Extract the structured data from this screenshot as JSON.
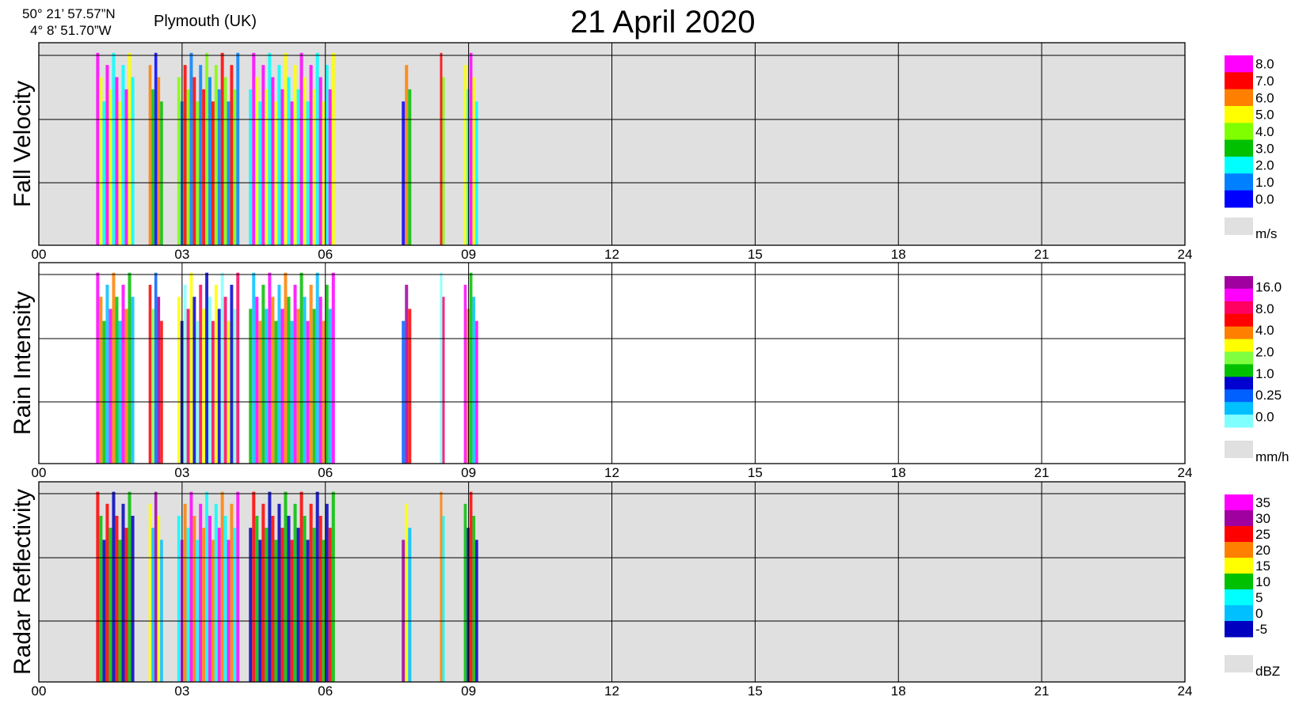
{
  "header": {
    "lat": "50° 21’ 57.57”N",
    "lon": "4°  8’ 51.70”W",
    "location": "Plymouth (UK)",
    "date": "21 April 2020"
  },
  "chart_data": [
    {
      "type": "heatmap",
      "ylabel": "Fall Velocity",
      "x_ticks": [
        "00",
        "03",
        "06",
        "09",
        "12",
        "15",
        "18",
        "21",
        "24"
      ],
      "xlim": [
        0,
        24
      ],
      "colorbar": {
        "labels": [
          "8.0",
          "7.0",
          "6.0",
          "5.0",
          "4.0",
          "3.0",
          "2.0",
          "1.0",
          "0.0"
        ],
        "colors": [
          "#ff00ff",
          "#ff0000",
          "#ff7f00",
          "#ffff00",
          "#7fff00",
          "#00c000",
          "#00ffff",
          "#0080ff",
          "#0000ff"
        ],
        "nodata_color": "#e0e0e0",
        "unit": "m/s"
      },
      "background": "#e0e0e0",
      "precip_intervals": [
        [
          1.2,
          2.0
        ],
        [
          2.3,
          2.6
        ],
        [
          2.9,
          4.2
        ],
        [
          4.4,
          6.2
        ],
        [
          7.6,
          7.8
        ],
        [
          8.4,
          8.5
        ],
        [
          8.9,
          9.2
        ]
      ],
      "dominant_values": [
        4.0,
        6.0,
        7.0,
        5.0,
        1.0,
        0.0,
        3.0
      ]
    },
    {
      "type": "heatmap",
      "ylabel": "Rain Intensity",
      "x_ticks": [
        "00",
        "03",
        "06",
        "09",
        "12",
        "15",
        "18",
        "21",
        "24"
      ],
      "xlim": [
        0,
        24
      ],
      "colorbar": {
        "labels": [
          "16.0",
          "8.0",
          "4.0",
          "2.0",
          "1.0",
          "0.25",
          "0.0"
        ],
        "colors": [
          "#a000a0",
          "#ff00ff",
          "#ff0060",
          "#ff0000",
          "#ff8000",
          "#ffff00",
          "#80ff40",
          "#00c000",
          "#0000d0",
          "#0060ff",
          "#00c0ff",
          "#80ffff"
        ],
        "nodata_color": "#e0e0e0",
        "unit": "mm/h"
      },
      "background": "#ffffff",
      "precip_intervals": [
        [
          1.2,
          2.0
        ],
        [
          2.3,
          2.6
        ],
        [
          2.9,
          4.2
        ],
        [
          4.4,
          6.2
        ],
        [
          7.6,
          7.8
        ],
        [
          8.4,
          8.5
        ],
        [
          8.9,
          9.2
        ]
      ],
      "dominant_values": [
        0.25,
        1.0,
        4.0,
        0.25,
        0.0,
        0.0,
        2.0
      ]
    },
    {
      "type": "heatmap",
      "ylabel": "Radar Reflectivity",
      "x_ticks": [
        "00",
        "03",
        "06",
        "09",
        "12",
        "15",
        "18",
        "21",
        "24"
      ],
      "xlim": [
        0,
        24
      ],
      "colorbar": {
        "labels": [
          "35",
          "30",
          "25",
          "20",
          "15",
          "10",
          "5",
          "0",
          "-5"
        ],
        "colors": [
          "#ff00ff",
          "#a000a0",
          "#ff0000",
          "#ff7f00",
          "#ffff00",
          "#00c000",
          "#00ffff",
          "#00c0ff",
          "#0000c0"
        ],
        "nodata_color": "#e0e0e0",
        "unit": "dBZ"
      },
      "background": "#e0e0e0",
      "precip_intervals": [
        [
          1.2,
          2.0
        ],
        [
          2.3,
          2.6
        ],
        [
          2.9,
          4.2
        ],
        [
          4.4,
          6.2
        ],
        [
          7.6,
          7.8
        ],
        [
          8.4,
          8.5
        ],
        [
          8.9,
          9.2
        ]
      ],
      "dominant_values": [
        15,
        25,
        30,
        20,
        10,
        5,
        15
      ]
    }
  ]
}
